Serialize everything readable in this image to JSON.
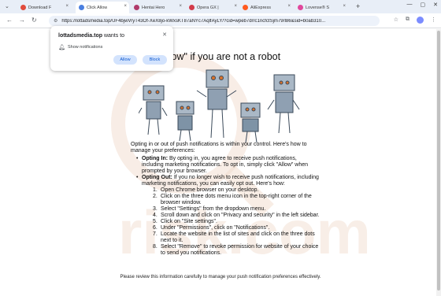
{
  "tabs": [
    {
      "title": "Download F",
      "favicon_color": "#e14b3b",
      "active": false
    },
    {
      "title": "Click Allow",
      "favicon_color": "#4a7fe0",
      "active": true
    },
    {
      "title": "Hentai Hero",
      "favicon_color": "#b03a6a",
      "active": false
    },
    {
      "title": "Opera GX |",
      "favicon_color": "#d33a4a",
      "active": false
    },
    {
      "title": "AliExpress",
      "favicon_color": "#ff5a1f",
      "active": false
    },
    {
      "title": "Lovense® S",
      "favicon_color": "#e0479c",
      "active": false
    }
  ],
  "address_bar": {
    "url": "https://lottadsmedia.top/UF4bjwVryT43Of-XeX8jo-kWxsKT87aNYc7AqlfAyLY/?cid=wpeb7drrc1ncfctSjm79rl86&sid=b0ab310..."
  },
  "popup": {
    "site": "lottadsmedia.top",
    "wants_to": "wants to",
    "permission": "Show notifications",
    "allow_label": "Allow",
    "block_label": "Block"
  },
  "page": {
    "headline": "llow\" if you are not a robot",
    "intro": "Opting in or out of push notifications is within your control. Here's how to manage your preferences:",
    "opt_in_label": "Opting In:",
    "opt_in_text": " By opting in, you agree to receive push notifications, including marketing notifications. To opt in, simply click \"Allow\" when prompted by your browser.",
    "opt_out_label": "Opting Out:",
    "opt_out_text": " If you no longer wish to receive push notifications, including marketing notifications, you can easily opt out. Here's how:",
    "steps": [
      {
        "num": "1.",
        "text": "Open Chrome browser on your desktop."
      },
      {
        "num": "2.",
        "text": "Click on the three dots menu icon in the top-right corner of the browser window."
      },
      {
        "num": "3.",
        "text": "Select \"Settings\" from the dropdown menu."
      },
      {
        "num": "4.",
        "text": "Scroll down and click on \"Privacy and security\" in the left sidebar."
      },
      {
        "num": "5.",
        "text": "Click on \"Site settings\"."
      },
      {
        "num": "6.",
        "text": "Under \"Permissions\", click on \"Notifications\"."
      },
      {
        "num": "7.",
        "text": "Locate the website in the list of sites and click on the three dots next to it."
      },
      {
        "num": "8.",
        "text": "Select \"Remove\" to revoke permission for website of your choice to send you notifications."
      }
    ],
    "footer": "Please review this information carefully to manage your push notification preferences effectively."
  },
  "watermark_text": "risk.com",
  "colors": {
    "accent": "#0b57d0",
    "tabstrip": "#e8eef7",
    "omnibox": "#edf2fa"
  }
}
